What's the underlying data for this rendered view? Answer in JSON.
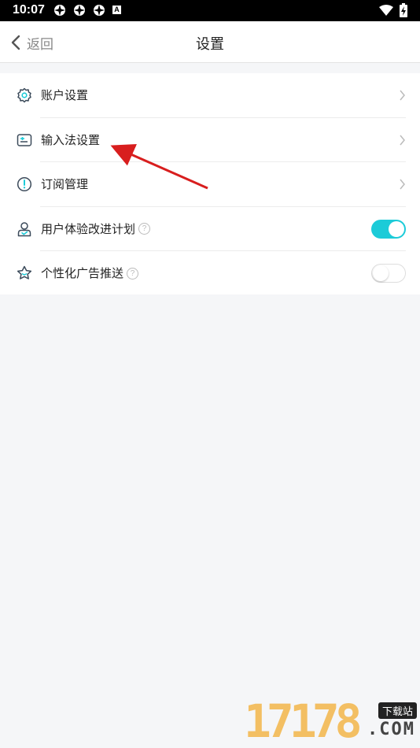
{
  "status_bar": {
    "time": "10:07",
    "icons": [
      "pinwheel-icon",
      "pinwheel-icon",
      "pinwheel-icon",
      "a-icon",
      "wifi-icon",
      "battery-charging-icon"
    ]
  },
  "header": {
    "back_label": "返回",
    "title": "设置"
  },
  "settings": {
    "items": [
      {
        "label": "账户设置",
        "icon": "gear-icon",
        "control": "chevron"
      },
      {
        "label": "输入法设置",
        "icon": "keyboard-card-icon",
        "control": "chevron"
      },
      {
        "label": "订阅管理",
        "icon": "exclamation-circle-icon",
        "control": "chevron"
      },
      {
        "label": "用户体验改进计划",
        "icon": "user-experience-icon",
        "control": "toggle",
        "toggle_on": true,
        "help": "?"
      },
      {
        "label": "个性化广告推送",
        "icon": "star-face-icon",
        "control": "toggle",
        "toggle_on": false,
        "help": "?"
      }
    ]
  },
  "colors": {
    "accent": "#1ccbd8",
    "annotation_arrow": "#d81e1e",
    "background": "#f5f6f8"
  },
  "watermark": {
    "number": "17178",
    "tag": "下载站",
    "domain": ".COM"
  }
}
